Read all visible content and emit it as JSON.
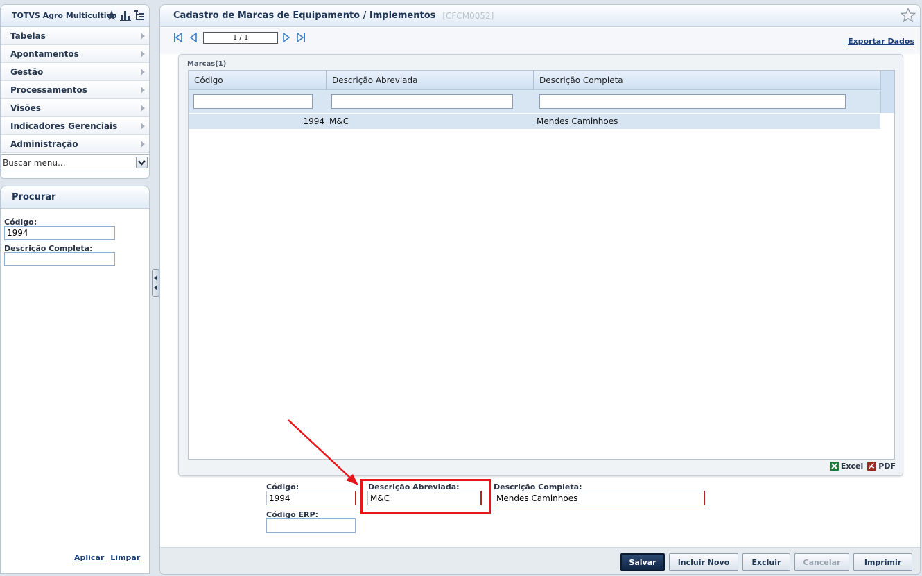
{
  "app": {
    "name": "TOTVS Agro Multicultivo"
  },
  "menu": {
    "items": [
      {
        "label": "Tabelas"
      },
      {
        "label": "Apontamentos"
      },
      {
        "label": "Gestão"
      },
      {
        "label": "Processamentos"
      },
      {
        "label": "Visões"
      },
      {
        "label": "Indicadores Gerenciais"
      },
      {
        "label": "Administração"
      }
    ],
    "search_placeholder": "Buscar menu..."
  },
  "search_panel": {
    "title": "Procurar",
    "codigo_label": "Código:",
    "codigo_value": "1994",
    "descricao_label": "Descrição Completa:",
    "descricao_value": "",
    "apply_label": "Aplicar",
    "clear_label": "Limpar"
  },
  "page": {
    "title": "Cadastro de Marcas de Equipamento / Implementos",
    "code": "[CFCM0052]",
    "pager": "1 / 1",
    "export_label": "Exportar Dados"
  },
  "grid": {
    "caption": "Marcas(1)",
    "columns": [
      "Código",
      "Descrição Abreviada",
      "Descrição Completa"
    ],
    "rows": [
      {
        "codigo": "1994",
        "abreviada": "M&C",
        "completa": "Mendes Caminhoes"
      }
    ],
    "export_excel": "Excel",
    "export_pdf": "PDF"
  },
  "form": {
    "codigo_label": "Código:",
    "codigo_value": "1994",
    "abreviada_label": "Descrição Abreviada:",
    "abreviada_value": "M&C",
    "completa_label": "Descrição Completa:",
    "completa_value": "Mendes Caminhoes",
    "erp_label": "Código ERP:",
    "erp_value": ""
  },
  "buttons": {
    "save": "Salvar",
    "new": "Incluir Novo",
    "delete": "Excluir",
    "cancel": "Cancelar",
    "print": "Imprimir"
  },
  "colors": {
    "accent": "#1f3555",
    "highlight": "#e8151b",
    "row_selected": "#d7e4f2"
  }
}
